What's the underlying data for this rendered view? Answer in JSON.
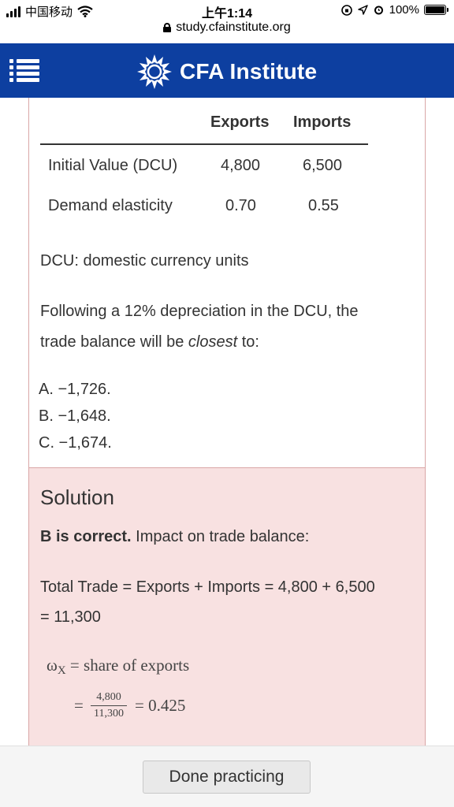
{
  "status_bar": {
    "carrier": "中国移动",
    "time": "上午1:14",
    "battery": "100%"
  },
  "browser": {
    "url": "study.cfainstitute.org"
  },
  "header": {
    "brand": "CFA Institute"
  },
  "question": {
    "table": {
      "headers": [
        "Exports",
        "Imports"
      ],
      "rows": [
        {
          "label": "Initial Value (DCU)",
          "exports": "4,800",
          "imports": "6,500"
        },
        {
          "label": "Demand elasticity",
          "exports": "0.70",
          "imports": "0.55"
        }
      ]
    },
    "note": "DCU: domestic currency units",
    "prompt_part1": "Following a 12% depreciation in the DCU, the",
    "prompt_part2": "trade balance will be ",
    "prompt_emph": "closest",
    "prompt_part3": " to:",
    "options": [
      "A.  −1,726.",
      "B.  −1,648.",
      "C.  −1,674."
    ]
  },
  "solution": {
    "title": "Solution",
    "verdict": "B is correct.",
    "verdict_rest": " Impact on trade balance:",
    "line1": "Total Trade = Exports + Imports = 4,800 + 6,500",
    "line2": "= 11,300",
    "omega": "ω",
    "omega_sub": "X",
    "omega_def": " = share of exports",
    "eq_sign": "=",
    "frac_num": "4,800",
    "frac_den": "11,300",
    "result": "= 0.425"
  },
  "footer": {
    "done_label": "Done practicing"
  },
  "colors": {
    "header_bg": "#0d3fa0",
    "solution_bg": "#f8e1e1",
    "card_border": "#d9a7a7"
  }
}
